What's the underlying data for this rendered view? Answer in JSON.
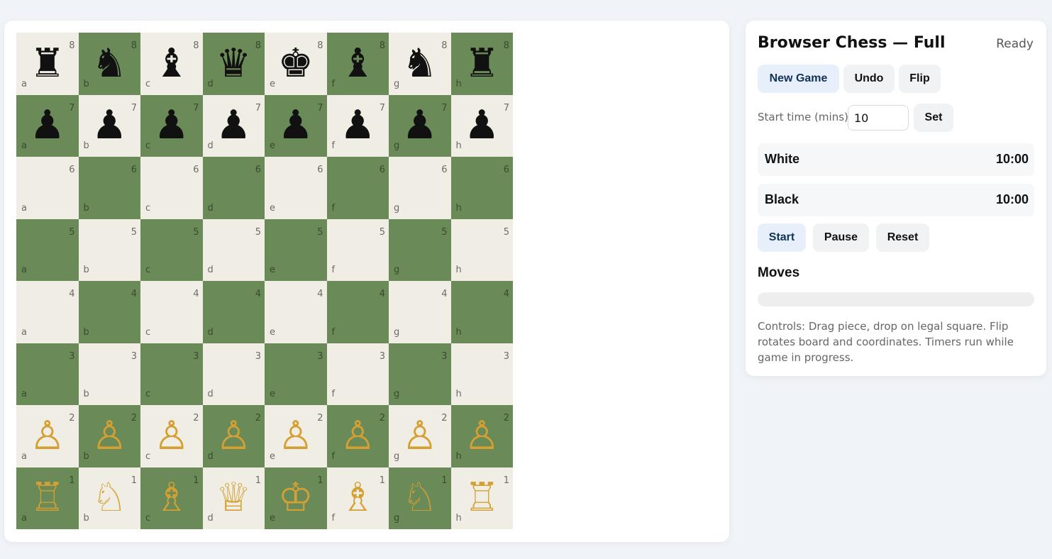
{
  "board": {
    "files": [
      "a",
      "b",
      "c",
      "d",
      "e",
      "f",
      "g",
      "h"
    ],
    "ranks": [
      "8",
      "7",
      "6",
      "5",
      "4",
      "3",
      "2",
      "1"
    ],
    "pieces": {
      "a8": "♜",
      "b8": "♞",
      "c8": "♝",
      "d8": "♛",
      "e8": "♚",
      "f8": "♝",
      "g8": "♞",
      "h8": "♜",
      "a7": "♟",
      "b7": "♟",
      "c7": "♟",
      "d7": "♟",
      "e7": "♟",
      "f7": "♟",
      "g7": "♟",
      "h7": "♟",
      "a2": "♙",
      "b2": "♙",
      "c2": "♙",
      "d2": "♙",
      "e2": "♙",
      "f2": "♙",
      "g2": "♙",
      "h2": "♙",
      "a1": "♖",
      "b1": "♘",
      "c1": "♗",
      "d1": "♕",
      "e1": "♔",
      "f1": "♗",
      "g1": "♘",
      "h1": "♖"
    },
    "colors": {
      "light_square": "#f0eee4",
      "dark_square": "#6a8a57",
      "white_piece": "#d4a033",
      "black_piece": "#111111"
    }
  },
  "panel": {
    "title": "Browser Chess — Full",
    "status": "Ready",
    "new_game_label": "New Game",
    "undo_label": "Undo",
    "flip_label": "Flip",
    "start_time_label": "Start time (mins):",
    "start_time_value": "10",
    "set_label": "Set",
    "clocks": {
      "white_name": "White",
      "white_time": "10:00",
      "black_name": "Black",
      "black_time": "10:00"
    },
    "start_label": "Start",
    "pause_label": "Pause",
    "reset_label": "Reset",
    "moves_title": "Moves",
    "help_text": "Controls: Drag piece, drop on legal square. Flip rotates board and coordinates. Timers run while game in progress."
  }
}
